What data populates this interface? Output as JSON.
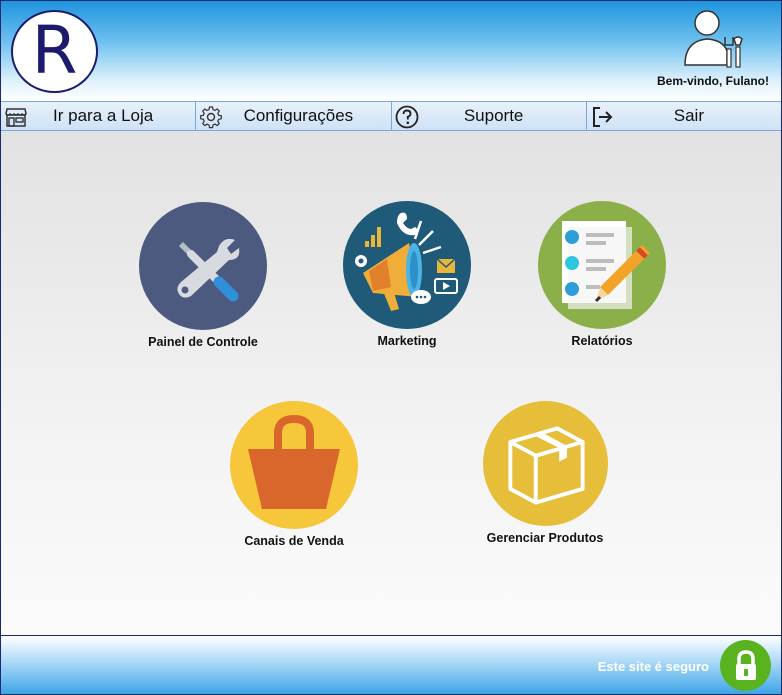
{
  "header": {
    "logo_letter": "R",
    "welcome": "Bem-vindo, Fulano!"
  },
  "nav": {
    "items": [
      {
        "label": "Ir para a Loja",
        "icon": "store-icon"
      },
      {
        "label": "Configurações",
        "icon": "gear-icon"
      },
      {
        "label": "Suporte",
        "icon": "help-icon"
      },
      {
        "label": "Sair",
        "icon": "logout-icon"
      }
    ]
  },
  "tiles": [
    {
      "label": "Painel de Controle",
      "icon": "tools-icon",
      "color": "#4d5a80"
    },
    {
      "label": "Marketing",
      "icon": "megaphone-icon",
      "color": "#1f5a78"
    },
    {
      "label": "Relatórios",
      "icon": "report-icon",
      "color": "#8bb04a"
    },
    {
      "label": "Canais de Venda",
      "icon": "shopping-bag-icon",
      "color": "#f6c73b"
    },
    {
      "label": "Gerenciar Produtos",
      "icon": "box-icon",
      "color": "#e6be3a"
    }
  ],
  "footer": {
    "secure_text": "Este site é seguro",
    "accent": "#59b31f"
  }
}
